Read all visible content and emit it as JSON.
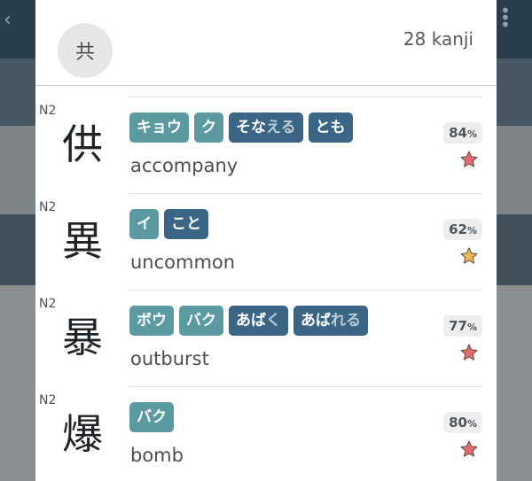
{
  "header": {
    "avatar_char": "共",
    "count_label": "28 kanji"
  },
  "colors": {
    "onyomi_chip": "#5b9aa0",
    "kunyomi_chip": "#3a6584",
    "star_red": "#e56b73",
    "star_gold": "#e8b95a"
  },
  "kanji_list": [
    {
      "level": "N2",
      "kanji": "供",
      "readings": [
        {
          "kind": "on",
          "text": "キョウ",
          "okurigana": ""
        },
        {
          "kind": "on",
          "text": "ク",
          "okurigana": ""
        },
        {
          "kind": "kun",
          "text": "そな",
          "okurigana": "える"
        },
        {
          "kind": "kun",
          "text": "とも",
          "okurigana": ""
        }
      ],
      "meaning": "accompany",
      "percent": "84",
      "percent_unit": "%",
      "star_icon": "star-red-icon",
      "star_color": "#e56b73"
    },
    {
      "level": "N2",
      "kanji": "異",
      "readings": [
        {
          "kind": "on",
          "text": "イ",
          "okurigana": ""
        },
        {
          "kind": "kun",
          "text": "こと",
          "okurigana": ""
        }
      ],
      "meaning": "uncommon",
      "percent": "62",
      "percent_unit": "%",
      "star_icon": "star-gold-icon",
      "star_color": "#e8b95a"
    },
    {
      "level": "N2",
      "kanji": "暴",
      "readings": [
        {
          "kind": "on",
          "text": "ボウ",
          "okurigana": ""
        },
        {
          "kind": "on",
          "text": "バク",
          "okurigana": ""
        },
        {
          "kind": "kun",
          "text": "あば",
          "okurigana": "く"
        },
        {
          "kind": "kun",
          "text": "あば",
          "okurigana": "れる"
        }
      ],
      "meaning": "outburst",
      "percent": "77",
      "percent_unit": "%",
      "star_icon": "star-red-icon",
      "star_color": "#e56b73"
    },
    {
      "level": "N2",
      "kanji": "爆",
      "readings": [
        {
          "kind": "on",
          "text": "バク",
          "okurigana": ""
        }
      ],
      "meaning": "bomb",
      "percent": "80",
      "percent_unit": "%",
      "star_icon": "star-red-icon",
      "star_color": "#e56b73"
    }
  ]
}
